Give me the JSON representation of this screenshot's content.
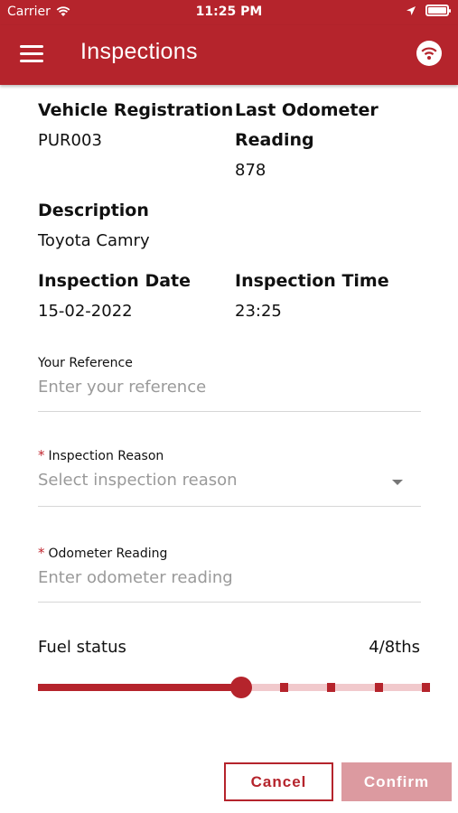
{
  "status_bar": {
    "carrier": "Carrier",
    "time": "11:25 PM"
  },
  "app_bar": {
    "title": "Inspections"
  },
  "details": {
    "vehicle_registration_label": "Vehicle Registration",
    "vehicle_registration_value": "PUR003",
    "last_odometer_label_line1": "Last Odometer",
    "last_odometer_label_line2": "Reading",
    "last_odometer_value": "878",
    "description_label": "Description",
    "description_value": "Toyota Camry",
    "inspection_date_label": "Inspection Date",
    "inspection_date_value": "15-02-2022",
    "inspection_time_label": "Inspection Time",
    "inspection_time_value": "23:25"
  },
  "form": {
    "reference_label": "Your Reference",
    "reference_placeholder": "Enter your reference",
    "reason_required": "*",
    "reason_label": "Inspection Reason",
    "reason_placeholder": "Select inspection reason",
    "odometer_required": "*",
    "odometer_label": "Odometer Reading",
    "odometer_placeholder": "Enter odometer reading"
  },
  "fuel": {
    "label": "Fuel status",
    "value_text": "4/8ths",
    "level": 4,
    "max": 8
  },
  "buttons": {
    "cancel": "Cancel",
    "confirm": "Confirm"
  },
  "colors": {
    "brand": "#b5242c",
    "confirm_disabled": "#dc9aa0",
    "track_light": "#f1c9cc"
  }
}
